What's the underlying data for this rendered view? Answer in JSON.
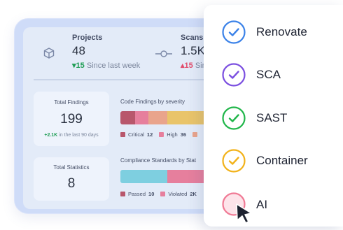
{
  "stats": {
    "projects": {
      "title": "Projects",
      "value": "48",
      "delta": "15",
      "delta_text": "Since last week",
      "icon": "cube-icon"
    },
    "scans": {
      "title": "Scans",
      "value": "1.5K",
      "delta": "15",
      "delta_text": "Sin",
      "icon": "commit-icon"
    }
  },
  "findings_card": {
    "title": "Total Findings",
    "value": "199",
    "delta": "+2.1K",
    "delta_text": "in the last 90 days"
  },
  "statistics_card": {
    "title": "Total Statistics",
    "value": "8"
  },
  "severity_chart": {
    "title": "Code Findings by severity",
    "legend": [
      {
        "label": "Critical",
        "value": "12",
        "color": "#b8576c"
      },
      {
        "label": "High",
        "value": "36",
        "color": "#e67f9d"
      },
      {
        "label": "",
        "value": "",
        "color": "#e9a48c"
      }
    ]
  },
  "compliance_chart": {
    "title": "Compliance Standards by Stat",
    "legend": [
      {
        "label": "Passed",
        "value": "10",
        "color": "#b8576c"
      },
      {
        "label": "Violated",
        "value": "2K",
        "color": "#e67f9d"
      }
    ]
  },
  "options": [
    {
      "label": "Renovate",
      "color": "#3b82e8",
      "fill": "#ffffff",
      "icon": "check-circle-icon"
    },
    {
      "label": "SCA",
      "color": "#7b4fe0",
      "fill": "#ffffff",
      "icon": "check-circle-icon"
    },
    {
      "label": "SAST",
      "color": "#20b64a",
      "fill": "#ffffff",
      "icon": "check-circle-icon"
    },
    {
      "label": "Container",
      "color": "#f2b21a",
      "fill": "#ffffff",
      "icon": "check-circle-icon"
    },
    {
      "label": "AI",
      "color": "#f07a95",
      "fill": "#fde4ea",
      "icon": "empty-circle-icon"
    }
  ],
  "colors": {
    "accent": "#3b82e8",
    "frame": "#cfdcf8",
    "inner": "#e3ebf8"
  }
}
